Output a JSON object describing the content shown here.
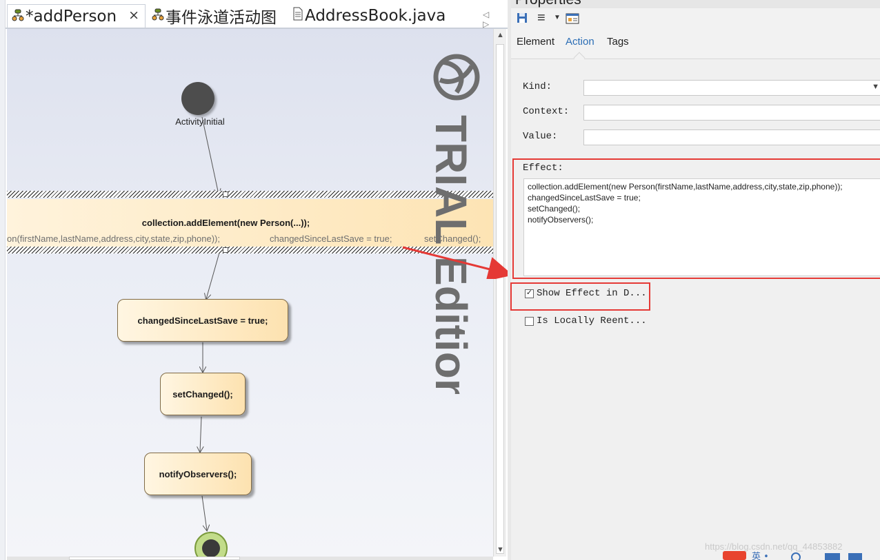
{
  "tabs": [
    {
      "label": "*addPerson",
      "active": true
    },
    {
      "label": "事件泳道活动图",
      "active": false
    },
    {
      "label": "AddressBook.java",
      "active": false
    }
  ],
  "tab_close": "×",
  "tab_nav": "◁ ▷",
  "diagram": {
    "initial_label": "ActivityInitial",
    "action_title": "collection.addElement(new Person(...));",
    "action_effect_parts": [
      "on(firstName,lastName,address,city,state,zip,phone));",
      "changedSinceLastSave = true;",
      "setChanged();"
    ],
    "nodes": [
      "changedSinceLastSave = true;",
      "setChanged();",
      "notifyObservers();"
    ],
    "watermark_text": "TRIAL Edition"
  },
  "properties": {
    "title": "Properties",
    "tabs": [
      "Element",
      "Action",
      "Tags"
    ],
    "active_tab": "Action",
    "kind_label": "Kind:",
    "kind_value": "",
    "context_label": "Context:",
    "context_value": "",
    "value_label": "Value:",
    "value_value": "",
    "effect_label": "Effect:",
    "effect_text": "collection.addElement(new Person(firstName,lastName,address,city,state,zip,phone));\nchangedSinceLastSave = true;\nsetChanged();\nnotifyObservers();",
    "show_effect_label": "Show Effect in D...",
    "show_effect_checked": true,
    "locally_reentrant_label": "Is Locally Reent...",
    "locally_reentrant_checked": false
  },
  "credit": "https://blog.csdn.net/qq_44853882",
  "annotation_color": "#e53935"
}
